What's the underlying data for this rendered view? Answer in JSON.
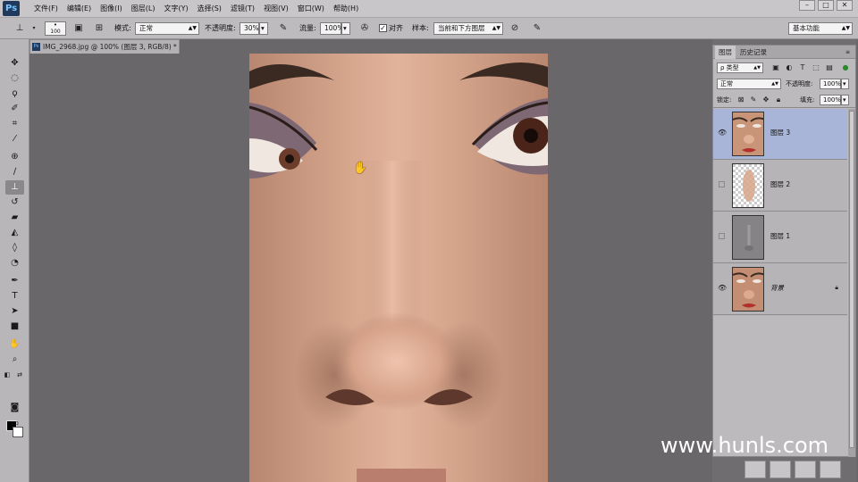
{
  "app": {
    "logo": "Ps",
    "menus": [
      "文件(F)",
      "编辑(E)",
      "图像(I)",
      "图层(L)",
      "文字(Y)",
      "选择(S)",
      "滤镜(T)",
      "视图(V)",
      "窗口(W)",
      "帮助(H)"
    ],
    "window_controls": [
      "–",
      "□",
      "✕"
    ]
  },
  "options": {
    "brush_size": "100",
    "mode_label": "模式:",
    "mode_value": "正常",
    "opacity_label": "不透明度:",
    "opacity_value": "30%",
    "flow_label": "流量:",
    "flow_value": "100%",
    "aligned_label": "对齐",
    "sample_label": "样本:",
    "sample_value": "当前和下方图层",
    "workspace": "基本功能"
  },
  "document": {
    "tab_title": "IMG_2968.jpg @ 100% (图层 3, RGB/8) *"
  },
  "panel": {
    "tabs": [
      "图层",
      "历史记录"
    ],
    "filter_kind": "ρ 类型",
    "blend_mode": "正常",
    "opacity_label": "不透明度:",
    "opacity_value": "100%",
    "lock_label": "锁定:",
    "fill_label": "填充:",
    "fill_value": "100%",
    "layers": [
      {
        "name": "图层 3",
        "visible": true,
        "selected": true
      },
      {
        "name": "图层 2",
        "visible": false,
        "selected": false
      },
      {
        "name": "图层 1",
        "visible": false,
        "selected": false
      },
      {
        "name": "背景",
        "visible": true,
        "selected": false,
        "locked": true
      }
    ]
  },
  "watermark": "www.hunls.com",
  "colors": {
    "foreground": "#000000",
    "background": "#ffffff",
    "selected_layer": "#a8b5d9"
  }
}
